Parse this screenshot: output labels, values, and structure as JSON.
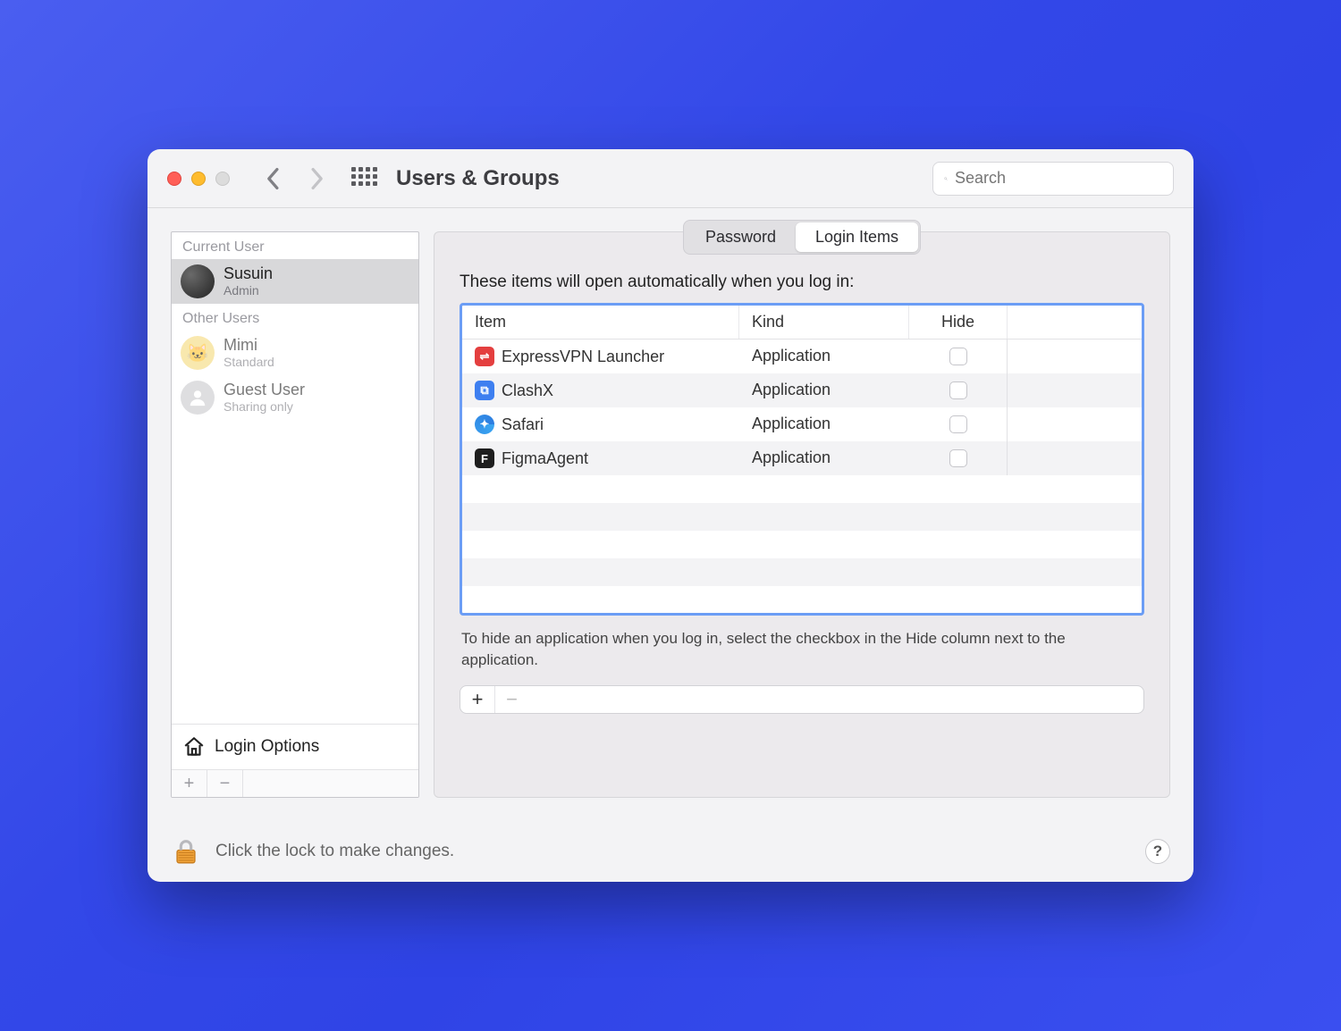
{
  "window": {
    "title": "Users & Groups",
    "search_placeholder": "Search"
  },
  "sidebar": {
    "current_label": "Current User",
    "other_label": "Other Users",
    "users": [
      {
        "name": "Susuin",
        "role": "Admin",
        "avatar": "susuin",
        "selected": true
      },
      {
        "name": "Mimi",
        "role": "Standard",
        "avatar": "yellow",
        "selected": false
      },
      {
        "name": "Guest User",
        "role": "Sharing only",
        "avatar": "gray",
        "selected": false
      }
    ],
    "login_options_label": "Login Options"
  },
  "tabs": {
    "password": "Password",
    "login_items": "Login Items",
    "active": "login_items"
  },
  "login_items": {
    "intro": "These items will open automatically when you log in:",
    "columns": {
      "item": "Item",
      "kind": "Kind",
      "hide": "Hide"
    },
    "rows": [
      {
        "name": "ExpressVPN Launcher",
        "kind": "Application",
        "hide": false,
        "icon": "expressvpn"
      },
      {
        "name": "ClashX",
        "kind": "Application",
        "hide": false,
        "icon": "clashx"
      },
      {
        "name": "Safari",
        "kind": "Application",
        "hide": false,
        "icon": "safari"
      },
      {
        "name": "FigmaAgent",
        "kind": "Application",
        "hide": false,
        "icon": "figma"
      }
    ],
    "hint": "To hide an application when you log in, select the checkbox in the Hide column next to the application."
  },
  "footer": {
    "lock_text": "Click the lock to make changes."
  }
}
